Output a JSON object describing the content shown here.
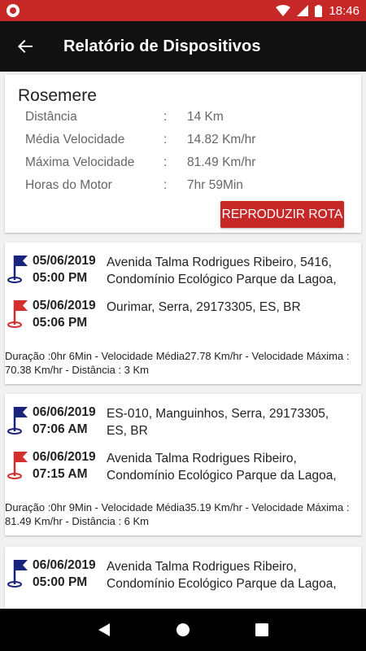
{
  "status_bar": {
    "time": "18:46"
  },
  "app_bar": {
    "title": "Relatório de Dispositivos"
  },
  "summary": {
    "device_name": "Rosemere",
    "rows": [
      {
        "label": "Distância",
        "sep": ":",
        "value": "14 Km"
      },
      {
        "label": "Média Velocidade",
        "sep": ":",
        "value": "14.82 Km/hr"
      },
      {
        "label": "Máxima Velocidade",
        "sep": ":",
        "value": "81.49 Km/hr"
      },
      {
        "label": "Horas do Motor",
        "sep": ":",
        "value": "7hr 59Min"
      }
    ],
    "replay_label": "REPRODUZIR ROTA"
  },
  "colors": {
    "start_flag": "#1a237e",
    "end_flag": "#d32f2f",
    "accent": "#c62828"
  },
  "trips": [
    {
      "start": {
        "date": "05/06/2019",
        "time": "05:00 PM",
        "address": "Avenida Talma Rodrigues Ribeiro, 5416,\nCondomínio Ecológico Parque da Lagoa,"
      },
      "end": {
        "date": "05/06/2019",
        "time": "05:06 PM",
        "address": "Ourimar, Serra, 29173305, ES, BR"
      },
      "summary": "Duração :0hr 6Min - Velocidade Média27.78 Km/hr - Velocidade Máxima : 70.38 Km/hr - Distância : 3 Km"
    },
    {
      "start": {
        "date": "06/06/2019",
        "time": "07:06 AM",
        "address": "ES-010, Manguinhos, Serra, 29173305,\nES, BR"
      },
      "end": {
        "date": "06/06/2019",
        "time": "07:15 AM",
        "address": "Avenida Talma Rodrigues Ribeiro,\nCondomínio Ecológico Parque da Lagoa,"
      },
      "summary": "Duração :0hr 9Min - Velocidade Média35.19 Km/hr - Velocidade Máxima : 81.49 Km/hr - Distância : 6 Km"
    },
    {
      "start": {
        "date": "06/06/2019",
        "time": "05:00 PM",
        "address": "Avenida Talma Rodrigues Ribeiro,\nCondomínio Ecológico Parque da Lagoa,"
      }
    }
  ]
}
